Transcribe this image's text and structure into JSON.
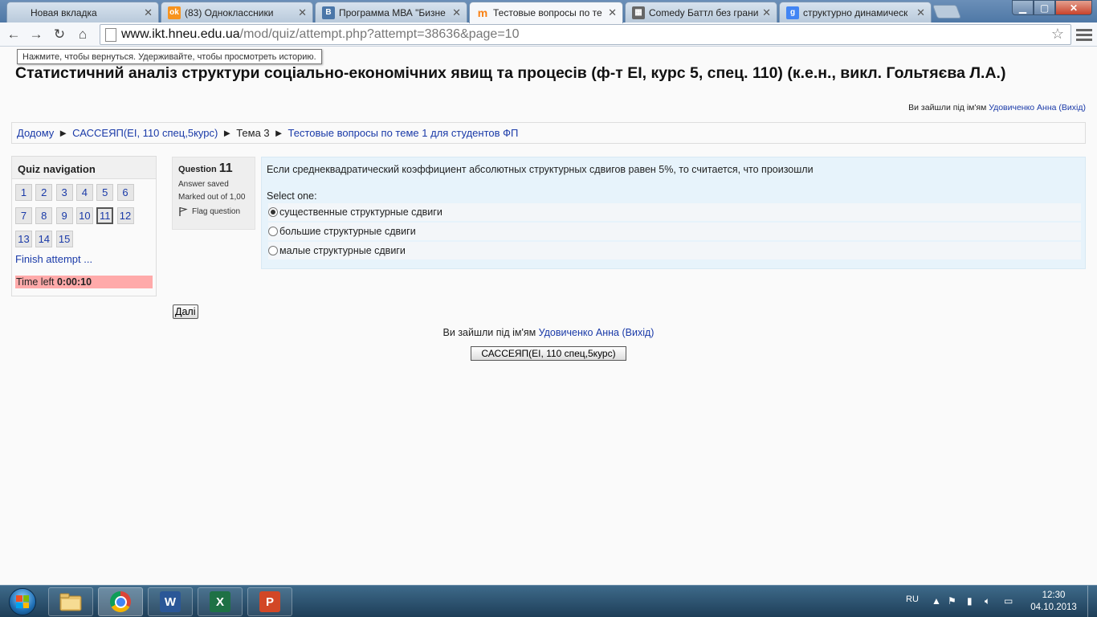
{
  "browser": {
    "tabs": [
      {
        "title": "Новая вкладка",
        "favicon": "blank-page-icon",
        "fav_color": "transparent"
      },
      {
        "title": "(83) Одноклассники",
        "favicon": "odnoklassniki-icon",
        "fav_color": "#f7931e"
      },
      {
        "title": "Программа МВА \"Бизне",
        "favicon": "vk-icon",
        "fav_color": "#4a76a8"
      },
      {
        "title": "Тестовые вопросы по те",
        "favicon": "moodle-icon",
        "fav_color": "#f98012"
      },
      {
        "title": "Comedy Баттл без грани",
        "favicon": "film-icon",
        "fav_color": "#666666"
      },
      {
        "title": "структурно динамическ",
        "favicon": "google-icon",
        "fav_color": "#4285f4"
      }
    ],
    "url_host": "www.ikt.hneu.edu.ua",
    "url_path": "/mod/quiz/attempt.php?attempt=38636&page=10",
    "back_tooltip": "Нажмите, чтобы вернуться. Удерживайте, чтобы просмотреть историю."
  },
  "page": {
    "course_title": "Статистичний аналіз структури соціально-економічних явищ та процесів (ф-т ЕІ, курс 5, спец. 110) (к.е.н., викл. Гольтяєва Л.А.)",
    "login_top": {
      "prefix": "Ви зайшли під ім'ям ",
      "user": "Удовиченко Анна",
      "logout": "(Вихід)"
    },
    "breadcrumb": [
      {
        "label": "Додому",
        "link": true
      },
      {
        "label": "САССЕЯП(ЕІ, 110 спец,5курс)",
        "link": true
      },
      {
        "label": "Тема 3",
        "link": false
      },
      {
        "label": "Тестовые вопросы по теме 1 для студентов ФП",
        "link": true
      }
    ],
    "breadcrumb_sep": "►",
    "quiz_nav": {
      "title": "Quiz navigation",
      "questions": [
        "1",
        "2",
        "3",
        "4",
        "5",
        "6",
        "7",
        "8",
        "9",
        "10",
        "11",
        "12",
        "13",
        "14",
        "15"
      ],
      "current": "11",
      "finish_label": "Finish attempt ...",
      "time_left_label": "Time left",
      "time_left_value": "0:00:10",
      "time_color": "#ffaaaa"
    },
    "question": {
      "label": "Question",
      "number": "11",
      "status": "Answer saved",
      "marked": "Marked out of 1,00",
      "flag_label": "Flag question",
      "text": "Если среднеквадратический коэффициент абсолютных структурных сдвигов равен 5%, то считается, что произошли",
      "select_one": "Select one:",
      "options": [
        {
          "label": "существенные структурные сдвиги",
          "checked": true
        },
        {
          "label": "большие структурные сдвиги",
          "checked": false
        },
        {
          "label": "малые структурные сдвиги",
          "checked": false
        }
      ]
    },
    "next_button": "Далі",
    "footer_login": {
      "prefix": "Ви зайшли під ім'ям ",
      "user": "Удовиченко Анна",
      "logout": "(Вихід)"
    },
    "course_button": "САССЕЯП(ЕІ, 110 спец,5курс)"
  },
  "taskbar": {
    "apps": [
      {
        "name": "explorer",
        "icon": "folder-icon"
      },
      {
        "name": "chrome",
        "icon": "chrome-icon"
      },
      {
        "name": "word",
        "icon": "word-icon",
        "letter": "W"
      },
      {
        "name": "excel",
        "icon": "excel-icon",
        "letter": "X"
      },
      {
        "name": "powerpoint",
        "icon": "powerpoint-icon",
        "letter": "P"
      }
    ],
    "lang": "RU",
    "time": "12:30",
    "date": "04.10.2013"
  }
}
